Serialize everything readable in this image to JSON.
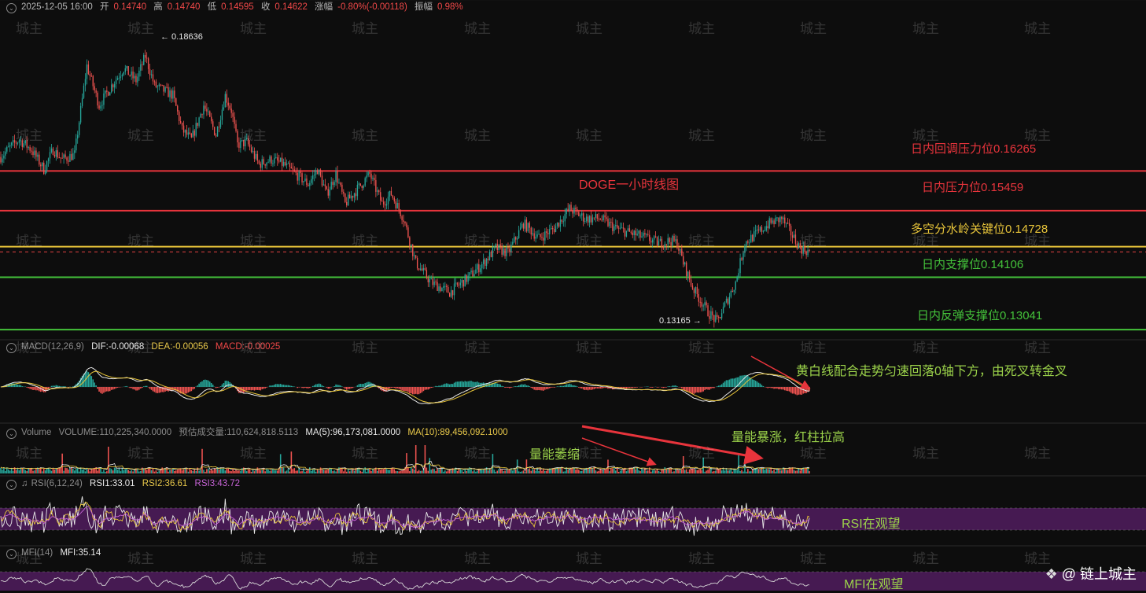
{
  "header": {
    "datetime": "2025-12-05 16:00",
    "open_label": "开",
    "open": "0.14740",
    "high_label": "高",
    "high": "0.14740",
    "low_label": "低",
    "low": "0.14595",
    "close_label": "收",
    "close": "0.14622",
    "change_label": "涨幅",
    "change": "-0.80%(-0.00118)",
    "amplitude_label": "振幅",
    "amplitude": "0.98%"
  },
  "price_chart": {
    "title": "DOGE一小时线图",
    "high_marker": "← 0.18636",
    "low_marker": "0.13165 →",
    "levels": [
      {
        "label": "日内回调压力位0.16265",
        "value": 0.16265,
        "color": "#e8343c"
      },
      {
        "label": "日内压力位0.15459",
        "value": 0.15459,
        "color": "#e8343c"
      },
      {
        "label": "多空分水岭关键位0.14728",
        "value": 0.14728,
        "color": "#e8c53a"
      },
      {
        "label": "日内支撑位0.14106",
        "value": 0.14106,
        "color": "#44c23a"
      },
      {
        "label": "日内反弹支撑位0.13041",
        "value": 0.13041,
        "color": "#44c23a"
      }
    ],
    "current_price": 0.14622,
    "colors": {
      "up": "#26a69a",
      "down": "#ef5350"
    }
  },
  "macd": {
    "label": "MACD(12,26,9)",
    "dif": "DIF:-0.00068",
    "dea": "DEA:-0.00056",
    "macd": "MACD:-0.00025",
    "annotation": "黄白线配合走势匀速回落0轴下方，由死叉转金叉"
  },
  "volume": {
    "label": "Volume",
    "volume": "VOLUME:110,225,340.0000",
    "estimated": "预估成交量:110,624,818.5113",
    "ma5": "MA(5):96,173,081.0000",
    "ma10": "MA(10):89,456,092.1000",
    "annotation_shrink": "量能萎缩",
    "annotation_surge": "量能暴涨，红柱拉高"
  },
  "rsi": {
    "label": "RSI(6,12,24)",
    "rsi1": "RSI1:33.01",
    "rsi2": "RSI2:36.61",
    "rsi3": "RSI3:43.72",
    "annotation": "RSI在观望"
  },
  "mfi": {
    "label": "MFI(14)",
    "mfi": "MFI:35.14",
    "annotation": "MFI在观望"
  },
  "watermark_text": "城主",
  "logo": "@ 链上城主",
  "chart_data": {
    "type": "candlestick",
    "ylim": [
      0.129,
      0.195
    ],
    "waypoints": [
      [
        0,
        0.1655
      ],
      [
        6,
        0.1675
      ],
      [
        12,
        0.169
      ],
      [
        20,
        0.167
      ],
      [
        28,
        0.163
      ],
      [
        34,
        0.167
      ],
      [
        40,
        0.165
      ],
      [
        48,
        0.166
      ],
      [
        56,
        0.184
      ],
      [
        64,
        0.176
      ],
      [
        72,
        0.18
      ],
      [
        80,
        0.1835
      ],
      [
        88,
        0.181
      ],
      [
        94,
        0.186
      ],
      [
        100,
        0.18
      ],
      [
        106,
        0.179
      ],
      [
        112,
        0.178
      ],
      [
        118,
        0.171
      ],
      [
        124,
        0.169
      ],
      [
        132,
        0.176
      ],
      [
        140,
        0.17
      ],
      [
        146,
        0.178
      ],
      [
        150,
        0.175
      ],
      [
        154,
        0.168
      ],
      [
        160,
        0.1685
      ],
      [
        168,
        0.164
      ],
      [
        176,
        0.165
      ],
      [
        184,
        0.164
      ],
      [
        192,
        0.162
      ],
      [
        200,
        0.16
      ],
      [
        206,
        0.163
      ],
      [
        212,
        0.158
      ],
      [
        218,
        0.162
      ],
      [
        224,
        0.156
      ],
      [
        232,
        0.159
      ],
      [
        240,
        0.162
      ],
      [
        248,
        0.156
      ],
      [
        254,
        0.158
      ],
      [
        262,
        0.153
      ],
      [
        270,
        0.144
      ],
      [
        280,
        0.14
      ],
      [
        292,
        0.138
      ],
      [
        304,
        0.141
      ],
      [
        314,
        0.144
      ],
      [
        322,
        0.147
      ],
      [
        330,
        0.146
      ],
      [
        340,
        0.152
      ],
      [
        350,
        0.149
      ],
      [
        360,
        0.151
      ],
      [
        370,
        0.155
      ],
      [
        380,
        0.153
      ],
      [
        390,
        0.153
      ],
      [
        400,
        0.151
      ],
      [
        410,
        0.15
      ],
      [
        420,
        0.149
      ],
      [
        428,
        0.148
      ],
      [
        436,
        0.1485
      ],
      [
        440,
        0.148
      ],
      [
        444,
        0.144
      ],
      [
        450,
        0.139
      ],
      [
        460,
        0.134
      ],
      [
        466,
        0.132
      ],
      [
        472,
        0.136
      ],
      [
        478,
        0.14
      ],
      [
        484,
        0.148
      ],
      [
        492,
        0.15
      ],
      [
        500,
        0.152
      ],
      [
        508,
        0.153
      ],
      [
        514,
        0.15
      ],
      [
        520,
        0.147
      ],
      [
        526,
        0.1462
      ]
    ]
  }
}
